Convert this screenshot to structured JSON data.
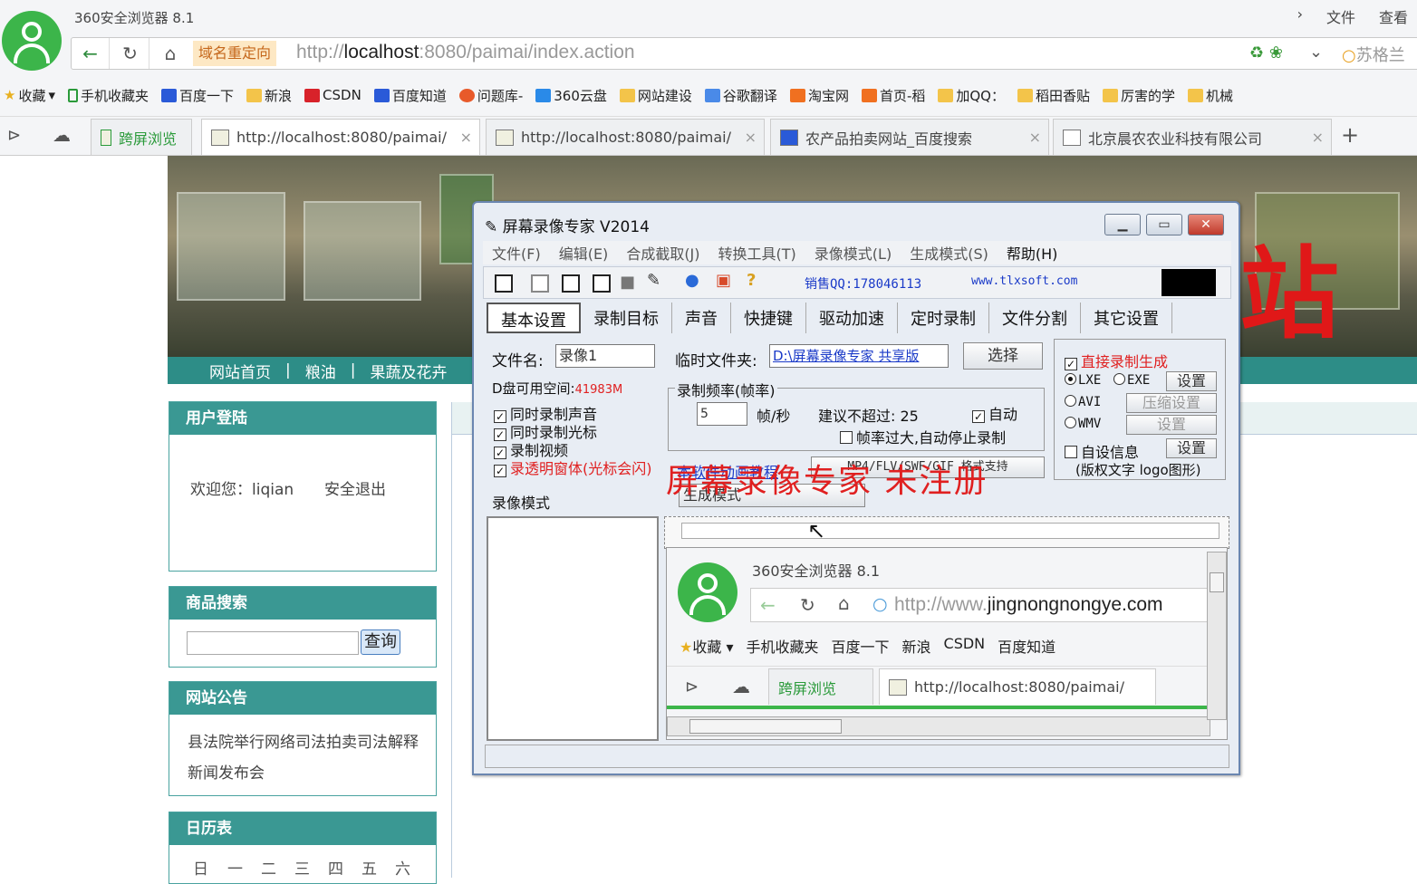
{
  "browser": {
    "app_title": "360安全浏览器 8.1",
    "menu": [
      "文件",
      "查看"
    ],
    "redirect_badge": "域名重定向",
    "url_prefix": "http://",
    "url_host": "localhost",
    "url_rest": ":8080/paimai/index.action",
    "search_placeholder": "苏格兰",
    "bookmarks": [
      "收藏",
      "手机收藏夹",
      "百度一下",
      "新浪",
      "CSDN",
      "百度知道",
      "问题库-",
      "360云盘",
      "网站建设",
      "谷歌翻译",
      "淘宝网",
      "首页-稻",
      "加QQ：",
      "稻田香贴",
      "厉害的学",
      "机械"
    ],
    "tab_button": "跨屏浏览",
    "tabs": [
      "http://localhost:8080/paimai/",
      "http://localhost:8080/paimai/",
      "农产品拍卖网站_百度搜索",
      "北京晨农农业科技有限公司"
    ]
  },
  "site": {
    "banner_char": "站",
    "nav": [
      "网站首页",
      "|",
      "粮油",
      "|",
      "果蔬及花卉"
    ],
    "login_header": "用户登陆",
    "welcome": "欢迎您：liqian",
    "logout": "安全退出",
    "search_header": "商品搜索",
    "search_button": "查询",
    "notice_header": "网站公告",
    "notice_text": "县法院举行网络司法拍卖司法解释新闻发布会",
    "calendar_header": "日历表",
    "calendar_days": [
      "日",
      "一",
      "二",
      "三",
      "四",
      "五",
      "六"
    ]
  },
  "recorder": {
    "title": "屏幕录像专家 V2014",
    "menu": [
      "文件(F)",
      "编辑(E)",
      "合成截取(J)",
      "转换工具(T)",
      "录像模式(L)",
      "生成模式(S)",
      "帮助(H)"
    ],
    "sales_qq": "销售QQ:178046113",
    "website": "www.tlxsoft.com",
    "tabs": [
      "基本设置",
      "录制目标",
      "声音",
      "快捷键",
      "驱动加速",
      "定时录制",
      "文件分割",
      "其它设置"
    ],
    "filename_label": "文件名:",
    "filename_value": "录像1",
    "tempdir_label": "临时文件夹:",
    "tempdir_value": "D:\\屏幕录像专家 共享版",
    "choose_button": "选择",
    "disk_label": "D盘可用空间:",
    "disk_value": "41983M",
    "fps_group": "录制频率(帧率)",
    "fps_value": "5",
    "fps_unit": "帧/秒",
    "fps_hint": "建议不超过: 25",
    "auto_label": "自动",
    "auto_stop_label": "帧率过大,自动停止录制",
    "check_sound": "同时录制声音",
    "check_cursor": "同时录制光标",
    "check_video": "录制视频",
    "check_transparent": "录透明窗体(光标会闪)",
    "tutorial_link": "本软件动画教程",
    "format_button": "MP4/FLV/SWF/GIF 格式支持",
    "direct_label": "直接录制生成",
    "lxe": "LXE",
    "exe": "EXE",
    "setting": "设置",
    "avi": "AVI",
    "compress_setting": "压缩设置",
    "wmv": "WMV",
    "custom_info": "自设信息",
    "custom_info_hint": "(版权文字 logo图形)",
    "record_mode_label": "录像模式",
    "gen_mode_label": "生成模式",
    "watermark": "屏幕录像专家 未注册"
  },
  "preview": {
    "app_title": "360安全浏览器 8.1",
    "url_prefix": "http://www.",
    "url_host": "jingnongnongye.com",
    "bookmarks": [
      "收藏",
      "手机收藏夹",
      "百度一下",
      "新浪",
      "CSDN",
      "百度知道"
    ],
    "tab_button": "跨屏浏览",
    "tab": "http://localhost:8080/paimai/"
  }
}
